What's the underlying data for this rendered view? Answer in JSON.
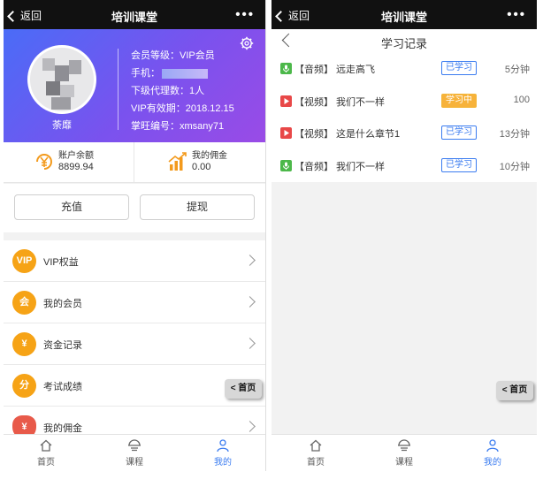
{
  "left": {
    "topbar": {
      "back_label": "返回",
      "title": "培训课堂",
      "more": "•••"
    },
    "profile": {
      "nickname": "荼靡",
      "member_level": "会员等级：VIP会员",
      "phone": "手机：",
      "sub_agents": "下级代理数：1人",
      "vip_expiry": "VIP有效期：2018.12.15",
      "wangwang": "掌旺编号：xmsany71"
    },
    "balance": {
      "label": "账户余额",
      "value": "8899.94"
    },
    "commission": {
      "label": "我的佣金",
      "value": "0.00"
    },
    "buttons": {
      "recharge": "充值",
      "withdraw": "提现"
    },
    "menu": [
      {
        "label": "VIP权益",
        "icon_text": "VIP",
        "icon": "vip-icon"
      },
      {
        "label": "我的会员",
        "icon_text": "会",
        "icon": "member-icon"
      },
      {
        "label": "资金记录",
        "icon_text": "¥",
        "icon": "yuan-icon"
      },
      {
        "label": "考试成绩",
        "icon_text": "分",
        "icon": "score-icon"
      },
      {
        "label": "我的佣金",
        "icon_text": "¥",
        "icon": "money-bag-icon"
      }
    ],
    "float_home": "< 首页",
    "tabs": [
      {
        "label": "首页",
        "icon": "home-icon"
      },
      {
        "label": "课程",
        "icon": "course-icon"
      },
      {
        "label": "我的",
        "icon": "user-icon"
      }
    ],
    "colors": {
      "accent": "#3b7cf0",
      "menu_icon": "#f6a316",
      "gradient_start": "#4a6cf7",
      "gradient_end": "#9a4be6"
    }
  },
  "right": {
    "topbar": {
      "back_label": "返回",
      "title": "培训课堂",
      "more": "•••"
    },
    "page_title": "学习记录",
    "records": [
      {
        "type": "audio",
        "text": "【音频】 远走高飞",
        "status": "已学习",
        "status_kind": "done",
        "duration": "5分钟"
      },
      {
        "type": "video",
        "text": "【视频】 我们不一样",
        "status": "学习中",
        "status_kind": "learning",
        "duration": "100"
      },
      {
        "type": "video",
        "text": "【视频】 这是什么章节1",
        "status": "已学习",
        "status_kind": "done",
        "duration": "13分钟"
      },
      {
        "type": "audio",
        "text": "【音频】 我们不一样",
        "status": "已学习",
        "status_kind": "done",
        "duration": "10分钟"
      }
    ],
    "float_home": "< 首页",
    "tabs": [
      {
        "label": "首页",
        "icon": "home-icon"
      },
      {
        "label": "课程",
        "icon": "course-icon"
      },
      {
        "label": "我的",
        "icon": "user-icon"
      }
    ],
    "colors": {
      "done": "#3b7cf0",
      "learning": "#f7b23a",
      "audio": "#4cb84a",
      "video": "#e84848"
    }
  }
}
